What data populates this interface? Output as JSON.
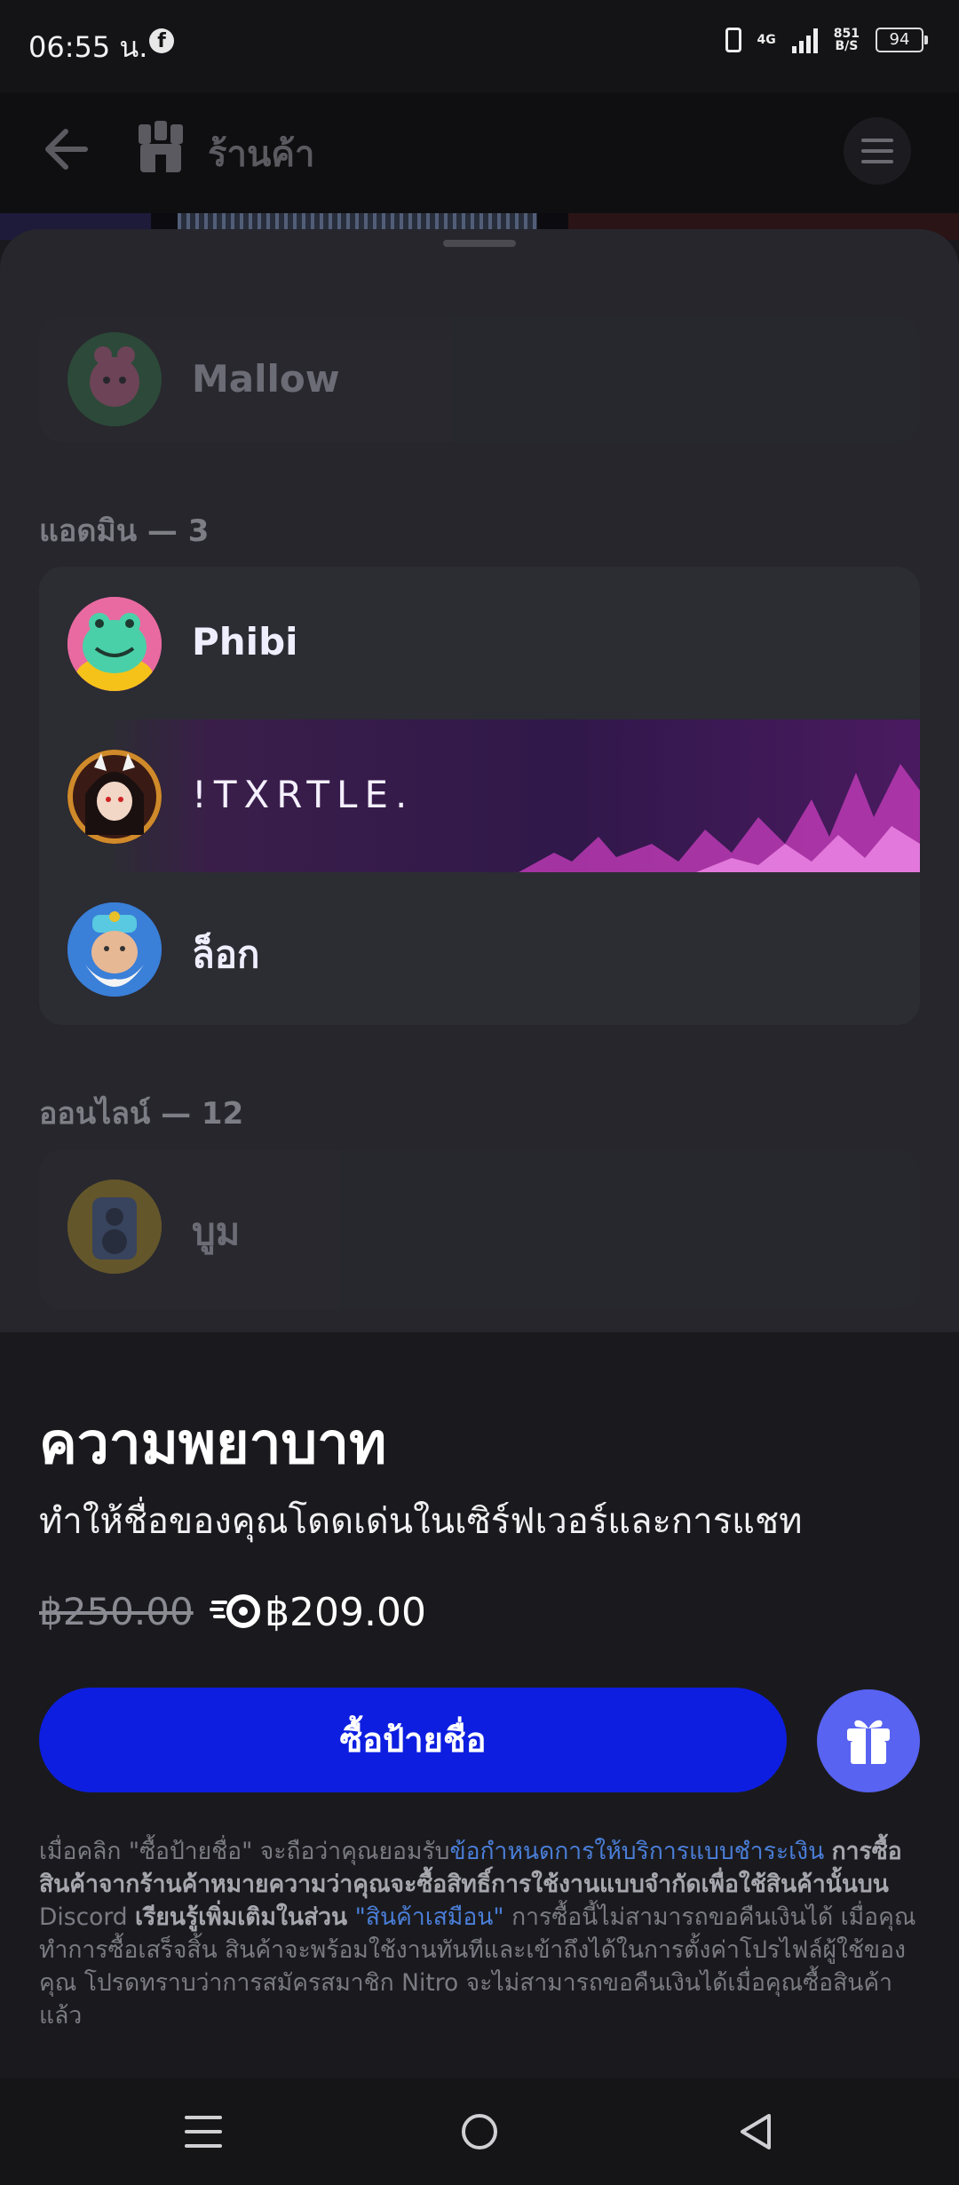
{
  "status_bar": {
    "time": "06:55 น.",
    "network_type": "4G",
    "net_speed_value": "851",
    "net_speed_unit": "B/S",
    "battery_level": "94"
  },
  "header": {
    "title": "ร้านค้า"
  },
  "members": {
    "top_member": "Mallow",
    "admin_section_label": "แอดมิน — 3",
    "admins": [
      {
        "name": "Phibi"
      },
      {
        "name": "!TXRTLE."
      },
      {
        "name": "ล็อก"
      }
    ],
    "online_section_label": "ออนไลน์ — 12",
    "online_first": "บูม"
  },
  "purchase": {
    "title": "ความพยาบาท",
    "subtitle": "ทำให้ชื่อของคุณโดดเด่นในเซิร์ฟเวอร์และการแชท",
    "price_original": "฿250.00",
    "price_nitro": "฿209.00",
    "buy_label": "ซื้อป้ายชื่อ",
    "fine_print": {
      "part1": "เมื่อคลิก \"ซื้อป้ายชื่อ\" จะถือว่าคุณยอมรับ",
      "link1": "ข้อกำหนดการให้บริการแบบชำระเงิน",
      "bold1": "การซื้อสินค้าจากร้านค้าหมายความว่าคุณจะซื้อสิทธิ์การใช้งานแบบจำกัดเพื่อใช้สินค้านั้นบน",
      "brand": "Discord",
      "bold2": "เรียนรู้เพิ่มเติมในส่วน",
      "link2": "\"สินค้าเสมือน\"",
      "part2": "การซื้อนี้ไม่สามารถขอคืนเงินได้ เมื่อคุณทำการซื้อเสร็จสิ้น สินค้าจะพร้อมใช้งานทันทีและเข้าถึงได้ในการตั้งค่าโปรไฟล์ผู้ใช้ของคุณ โปรดทราบว่าการสมัครสมาชิก Nitro จะไม่สามารถขอคืนเงินได้เมื่อคุณซื้อสินค้าแล้ว"
    }
  },
  "colors": {
    "buy_button": "#0d1ee0",
    "gift_button": "#5863f2",
    "link": "#4a7ed8"
  }
}
